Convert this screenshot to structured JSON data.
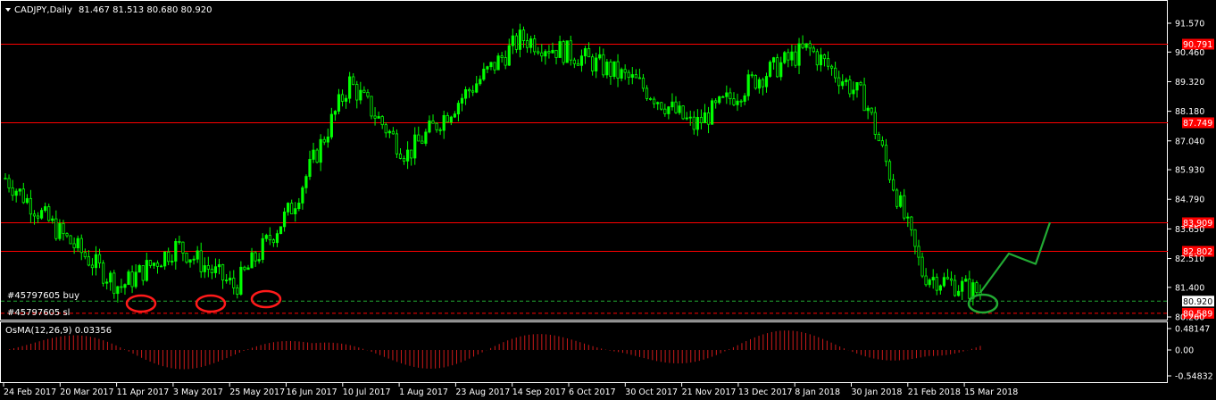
{
  "header": {
    "symbol_label": "CADJPY,Daily",
    "ohlc": "81.467 81.513 80.680 80.920"
  },
  "colors": {
    "background": "#000000",
    "grid": "#ffffff",
    "candle_up": "#00ff00",
    "candle_down": "#00ff00",
    "level_line": "#ff0000",
    "marker_circle_red": "#ff1a1a",
    "marker_circle_green": "#22aa33",
    "projection": "#22aa33",
    "osma_bars": "#cc1a1a",
    "axis_text": "#ffffff"
  },
  "price_axis": {
    "ticks": [
      "91.570",
      "90.460",
      "89.320",
      "88.180",
      "87.040",
      "85.930",
      "84.790",
      "83.650",
      "82.510",
      "81.400",
      "80.260"
    ],
    "min": 80.26,
    "max": 91.57
  },
  "levels": [
    {
      "value": "90.791",
      "color": "#ff0000"
    },
    {
      "value": "87.749",
      "color": "#ff0000"
    },
    {
      "value": "83.909",
      "color": "#ff0000"
    },
    {
      "value": "82.802",
      "color": "#ff0000"
    }
  ],
  "orders": [
    {
      "label": "#45797605 buy",
      "value": "80.920",
      "style": "dashed-green"
    },
    {
      "label": "#45797605 sl",
      "value": "80.589",
      "style": "dashed-red"
    }
  ],
  "indicator": {
    "label": "OsMA(12,26,9) 0.03356",
    "ticks": [
      "0.48147",
      "0.00",
      "-0.54832"
    ]
  },
  "time_axis": {
    "labels": [
      "24 Feb 2017",
      "20 Mar 2017",
      "11 Apr 2017",
      "3 May 2017",
      "25 May 2017",
      "16 Jun 2017",
      "10 Jul 2017",
      "1 Aug 2017",
      "23 Aug 2017",
      "14 Sep 2017",
      "6 Oct 2017",
      "30 Oct 2017",
      "21 Nov 2017",
      "13 Dec 2017",
      "8 Jan 2018",
      "30 Jan 2018",
      "21 Feb 2018",
      "15 Mar 2018"
    ]
  },
  "chart_data": {
    "type": "candlestick",
    "symbol": "CADJPY",
    "timeframe": "Daily",
    "x": [
      "24 Feb 2017",
      "20 Mar 2017",
      "11 Apr 2017",
      "3 May 2017",
      "25 May 2017",
      "16 Jun 2017",
      "10 Jul 2017",
      "1 Aug 2017",
      "23 Aug 2017",
      "14 Sep 2017",
      "6 Oct 2017",
      "30 Oct 2017",
      "21 Nov 2017",
      "13 Dec 2017",
      "8 Jan 2018",
      "30 Jan 2018",
      "21 Feb 2018",
      "15 Mar 2018"
    ],
    "close_approx": [
      85.6,
      83.4,
      81.4,
      83.0,
      81.4,
      84.5,
      89.3,
      86.5,
      88.8,
      91.0,
      90.3,
      89.3,
      87.6,
      89.3,
      90.6,
      88.6,
      81.9,
      81.2
    ],
    "projection_approx": [
      81.2,
      82.7,
      82.3,
      83.9
    ],
    "ylim": [
      80.26,
      91.57
    ],
    "levels": [
      90.791,
      87.749,
      83.909,
      82.802
    ],
    "buy_level": 80.92,
    "sl_level": 80.589
  }
}
